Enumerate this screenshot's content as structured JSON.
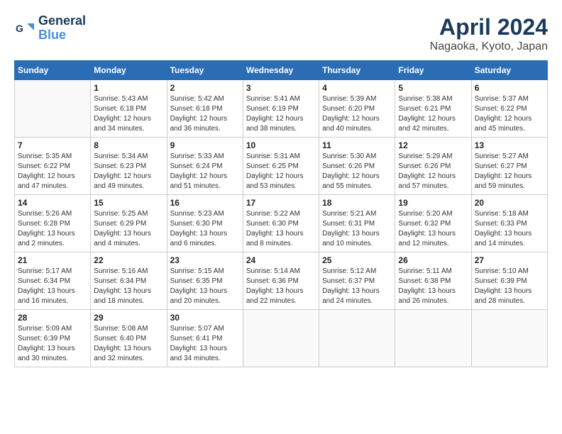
{
  "header": {
    "logo_line1": "General",
    "logo_line2": "Blue",
    "month": "April 2024",
    "location": "Nagaoka, Kyoto, Japan"
  },
  "weekdays": [
    "Sunday",
    "Monday",
    "Tuesday",
    "Wednesday",
    "Thursday",
    "Friday",
    "Saturday"
  ],
  "weeks": [
    [
      {
        "day": "",
        "info": ""
      },
      {
        "day": "1",
        "info": "Sunrise: 5:43 AM\nSunset: 6:18 PM\nDaylight: 12 hours\nand 34 minutes."
      },
      {
        "day": "2",
        "info": "Sunrise: 5:42 AM\nSunset: 6:18 PM\nDaylight: 12 hours\nand 36 minutes."
      },
      {
        "day": "3",
        "info": "Sunrise: 5:41 AM\nSunset: 6:19 PM\nDaylight: 12 hours\nand 38 minutes."
      },
      {
        "day": "4",
        "info": "Sunrise: 5:39 AM\nSunset: 6:20 PM\nDaylight: 12 hours\nand 40 minutes."
      },
      {
        "day": "5",
        "info": "Sunrise: 5:38 AM\nSunset: 6:21 PM\nDaylight: 12 hours\nand 42 minutes."
      },
      {
        "day": "6",
        "info": "Sunrise: 5:37 AM\nSunset: 6:22 PM\nDaylight: 12 hours\nand 45 minutes."
      }
    ],
    [
      {
        "day": "7",
        "info": "Sunrise: 5:35 AM\nSunset: 6:22 PM\nDaylight: 12 hours\nand 47 minutes."
      },
      {
        "day": "8",
        "info": "Sunrise: 5:34 AM\nSunset: 6:23 PM\nDaylight: 12 hours\nand 49 minutes."
      },
      {
        "day": "9",
        "info": "Sunrise: 5:33 AM\nSunset: 6:24 PM\nDaylight: 12 hours\nand 51 minutes."
      },
      {
        "day": "10",
        "info": "Sunrise: 5:31 AM\nSunset: 6:25 PM\nDaylight: 12 hours\nand 53 minutes."
      },
      {
        "day": "11",
        "info": "Sunrise: 5:30 AM\nSunset: 6:26 PM\nDaylight: 12 hours\nand 55 minutes."
      },
      {
        "day": "12",
        "info": "Sunrise: 5:29 AM\nSunset: 6:26 PM\nDaylight: 12 hours\nand 57 minutes."
      },
      {
        "day": "13",
        "info": "Sunrise: 5:27 AM\nSunset: 6:27 PM\nDaylight: 12 hours\nand 59 minutes."
      }
    ],
    [
      {
        "day": "14",
        "info": "Sunrise: 5:26 AM\nSunset: 6:28 PM\nDaylight: 13 hours\nand 2 minutes."
      },
      {
        "day": "15",
        "info": "Sunrise: 5:25 AM\nSunset: 6:29 PM\nDaylight: 13 hours\nand 4 minutes."
      },
      {
        "day": "16",
        "info": "Sunrise: 5:23 AM\nSunset: 6:30 PM\nDaylight: 13 hours\nand 6 minutes."
      },
      {
        "day": "17",
        "info": "Sunrise: 5:22 AM\nSunset: 6:30 PM\nDaylight: 13 hours\nand 8 minutes."
      },
      {
        "day": "18",
        "info": "Sunrise: 5:21 AM\nSunset: 6:31 PM\nDaylight: 13 hours\nand 10 minutes."
      },
      {
        "day": "19",
        "info": "Sunrise: 5:20 AM\nSunset: 6:32 PM\nDaylight: 13 hours\nand 12 minutes."
      },
      {
        "day": "20",
        "info": "Sunrise: 5:18 AM\nSunset: 6:33 PM\nDaylight: 13 hours\nand 14 minutes."
      }
    ],
    [
      {
        "day": "21",
        "info": "Sunrise: 5:17 AM\nSunset: 6:34 PM\nDaylight: 13 hours\nand 16 minutes."
      },
      {
        "day": "22",
        "info": "Sunrise: 5:16 AM\nSunset: 6:34 PM\nDaylight: 13 hours\nand 18 minutes."
      },
      {
        "day": "23",
        "info": "Sunrise: 5:15 AM\nSunset: 6:35 PM\nDaylight: 13 hours\nand 20 minutes."
      },
      {
        "day": "24",
        "info": "Sunrise: 5:14 AM\nSunset: 6:36 PM\nDaylight: 13 hours\nand 22 minutes."
      },
      {
        "day": "25",
        "info": "Sunrise: 5:12 AM\nSunset: 6:37 PM\nDaylight: 13 hours\nand 24 minutes."
      },
      {
        "day": "26",
        "info": "Sunrise: 5:11 AM\nSunset: 6:38 PM\nDaylight: 13 hours\nand 26 minutes."
      },
      {
        "day": "27",
        "info": "Sunrise: 5:10 AM\nSunset: 6:39 PM\nDaylight: 13 hours\nand 28 minutes."
      }
    ],
    [
      {
        "day": "28",
        "info": "Sunrise: 5:09 AM\nSunset: 6:39 PM\nDaylight: 13 hours\nand 30 minutes."
      },
      {
        "day": "29",
        "info": "Sunrise: 5:08 AM\nSunset: 6:40 PM\nDaylight: 13 hours\nand 32 minutes."
      },
      {
        "day": "30",
        "info": "Sunrise: 5:07 AM\nSunset: 6:41 PM\nDaylight: 13 hours\nand 34 minutes."
      },
      {
        "day": "",
        "info": ""
      },
      {
        "day": "",
        "info": ""
      },
      {
        "day": "",
        "info": ""
      },
      {
        "day": "",
        "info": ""
      }
    ]
  ]
}
